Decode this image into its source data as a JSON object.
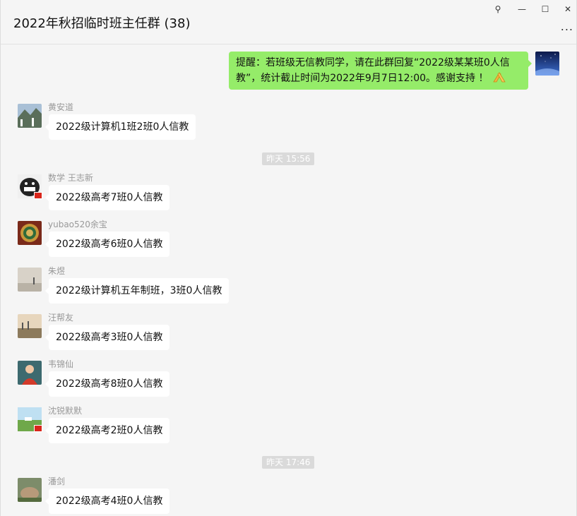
{
  "window": {
    "title": "2022年秋招临时班主任群 (38)",
    "pin_glyph": "⚲",
    "minimize_glyph": "—",
    "maximize_glyph": "☐",
    "close_glyph": "✕",
    "more_glyph": "..."
  },
  "my_message": {
    "text": "提醒：若班级无信教同学，请在此群回复“2022级某某班0人信教”，统计截止时间为2022年9月7日12:00。感谢支持 ！"
  },
  "timestamps": [
    "昨天 15:56",
    "昨天 17:46"
  ],
  "messages": [
    {
      "sender": "黄安道",
      "text": "2022级计算机1班2班0人信教"
    },
    {
      "sender": "数学 王志新",
      "text": "2022级高考7班0人信教"
    },
    {
      "sender": "yubao520余宝",
      "text": "2022级高考6班0人信教"
    },
    {
      "sender": "朱煜",
      "text": "2022级计算机五年制班，3班0人信教"
    },
    {
      "sender": "汪帮友",
      "text": "2022级高考3班0人信教"
    },
    {
      "sender": "韦锦仙",
      "text": "2022级高考8班0人信教"
    },
    {
      "sender": "沈锐默默",
      "text": "2022级高考2班0人信教"
    },
    {
      "sender": "潘剑",
      "text": "2022级高考4班0人信教"
    }
  ],
  "colors": {
    "my_bubble": "#95ec69",
    "other_bubble": "#ffffff",
    "background": "#f5f5f5"
  }
}
